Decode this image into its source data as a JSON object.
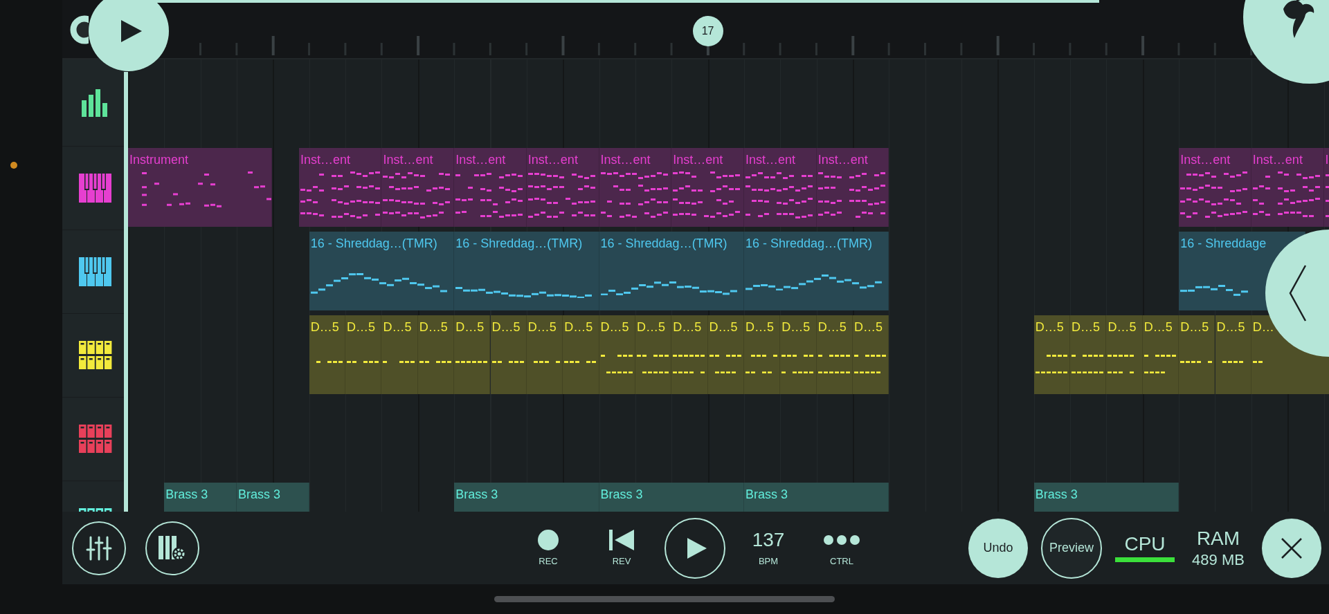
{
  "timeline": {
    "marker": "17"
  },
  "tracks": [
    {
      "kind": "mixer",
      "color": "#5ee39a"
    },
    {
      "kind": "keys",
      "color": "#e63fd0",
      "clips": [
        {
          "label": "Instrument"
        },
        {
          "label": "Inst…ent"
        },
        {
          "label": "Inst…ent"
        },
        {
          "label": "Inst…ent"
        },
        {
          "label": "Inst…ent"
        },
        {
          "label": "Inst…ent"
        },
        {
          "label": "Inst…ent"
        },
        {
          "label": "Inst…ent"
        },
        {
          "label": "Inst…ent"
        },
        {
          "label": "Inst…ent"
        },
        {
          "label": "Inst…ent"
        },
        {
          "label": "I"
        }
      ]
    },
    {
      "kind": "keys",
      "color": "#4fc8ef",
      "clips": [
        {
          "label": "16 - Shreddag…(TMR)"
        },
        {
          "label": "16 - Shreddag…(TMR)"
        },
        {
          "label": "16 - Shreddag…(TMR)"
        },
        {
          "label": "16 - Shreddag…(TMR)"
        },
        {
          "label": "16 - Shreddage"
        }
      ]
    },
    {
      "kind": "pads",
      "color": "#f2ea3c",
      "clips": [
        {
          "label": "D…5"
        },
        {
          "label": "D…5"
        },
        {
          "label": "D…5"
        },
        {
          "label": "D…5"
        },
        {
          "label": "D…5"
        },
        {
          "label": "D…5"
        },
        {
          "label": "D…5"
        },
        {
          "label": "D…5"
        },
        {
          "label": "D…5"
        },
        {
          "label": "D…5"
        },
        {
          "label": "D…5"
        },
        {
          "label": "D…5"
        },
        {
          "label": "D…5"
        },
        {
          "label": "D…5"
        },
        {
          "label": "D…5"
        },
        {
          "label": "D…5"
        },
        {
          "label": "D…5"
        },
        {
          "label": "D…5"
        },
        {
          "label": "D…5"
        },
        {
          "label": "D…5"
        },
        {
          "label": "D…5"
        },
        {
          "label": "D…5"
        },
        {
          "label": "D…"
        }
      ]
    },
    {
      "kind": "pads",
      "color": "#e8405a"
    },
    {
      "kind": "pads",
      "color": "#62eedc",
      "clips": [
        {
          "label": "Brass 3"
        },
        {
          "label": "Brass 3"
        },
        {
          "label": "Brass 3"
        },
        {
          "label": "Brass 3"
        },
        {
          "label": "Brass 3"
        },
        {
          "label": "Brass 3"
        }
      ]
    }
  ],
  "toolbar": {
    "transport": [
      {
        "kind": "rec",
        "label": "REC"
      },
      {
        "kind": "rev",
        "label": "REV"
      },
      {
        "kind": "play"
      },
      {
        "kind": "bpm",
        "value": "137",
        "label": "BPM"
      },
      {
        "kind": "ctrl",
        "label": "CTRL"
      }
    ],
    "undo": "Undo",
    "preview": "Preview",
    "cpu": {
      "label": "CPU",
      "level": 1
    },
    "ram": {
      "label": "RAM",
      "value": "489 MB"
    }
  }
}
